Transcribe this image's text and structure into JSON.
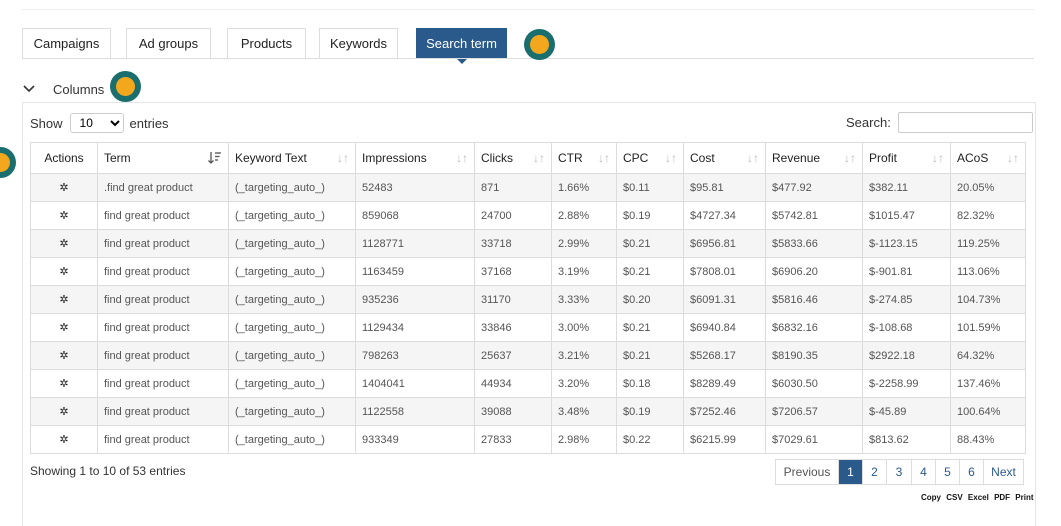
{
  "tabs": [
    {
      "label": "Campaigns",
      "active": false
    },
    {
      "label": "Ad groups",
      "active": false
    },
    {
      "label": "Products",
      "active": false
    },
    {
      "label": "Keywords",
      "active": false
    },
    {
      "label": "Search term",
      "active": true
    }
  ],
  "columns_toggle": {
    "label": "Columns"
  },
  "length": {
    "show": "Show",
    "value": "10",
    "entries": "entries"
  },
  "search": {
    "label": "Search:",
    "value": ""
  },
  "table": {
    "headers": [
      "Actions",
      "Term",
      "Keyword Text",
      "Impressions",
      "Clicks",
      "CTR",
      "CPC",
      "Cost",
      "Revenue",
      "Profit",
      "ACoS"
    ],
    "action_icon": "gear-icon",
    "rows": [
      {
        "action": "✲",
        "term": ".find great product",
        "keyword": "(_targeting_auto_)",
        "impressions": "52483",
        "clicks": "871",
        "ctr": "1.66%",
        "cpc": "$0.11",
        "cost": "$95.81",
        "revenue": "$477.92",
        "profit": "$382.11",
        "acos": "20.05%"
      },
      {
        "action": "✲",
        "term": "find great product",
        "keyword": "(_targeting_auto_)",
        "impressions": "859068",
        "clicks": "24700",
        "ctr": "2.88%",
        "cpc": "$0.19",
        "cost": "$4727.34",
        "revenue": "$5742.81",
        "profit": "$1015.47",
        "acos": "82.32%"
      },
      {
        "action": "✲",
        "term": "find great product",
        "keyword": "(_targeting_auto_)",
        "impressions": "1128771",
        "clicks": "33718",
        "ctr": "2.99%",
        "cpc": "$0.21",
        "cost": "$6956.81",
        "revenue": "$5833.66",
        "profit": "$-1123.15",
        "acos": "119.25%"
      },
      {
        "action": "✲",
        "term": "find great product",
        "keyword": "(_targeting_auto_)",
        "impressions": "1163459",
        "clicks": "37168",
        "ctr": "3.19%",
        "cpc": "$0.21",
        "cost": "$7808.01",
        "revenue": "$6906.20",
        "profit": "$-901.81",
        "acos": "113.06%"
      },
      {
        "action": "✲",
        "term": "find great product",
        "keyword": "(_targeting_auto_)",
        "impressions": "935236",
        "clicks": "31170",
        "ctr": "3.33%",
        "cpc": "$0.20",
        "cost": "$6091.31",
        "revenue": "$5816.46",
        "profit": "$-274.85",
        "acos": "104.73%"
      },
      {
        "action": "✲",
        "term": "find great product",
        "keyword": "(_targeting_auto_)",
        "impressions": "1129434",
        "clicks": "33846",
        "ctr": "3.00%",
        "cpc": "$0.21",
        "cost": "$6940.84",
        "revenue": "$6832.16",
        "profit": "$-108.68",
        "acos": "101.59%"
      },
      {
        "action": "✲",
        "term": "find great product",
        "keyword": "(_targeting_auto_)",
        "impressions": "798263",
        "clicks": "25637",
        "ctr": "3.21%",
        "cpc": "$0.21",
        "cost": "$5268.17",
        "revenue": "$8190.35",
        "profit": "$2922.18",
        "acos": "64.32%"
      },
      {
        "action": "✲",
        "term": "find great product",
        "keyword": "(_targeting_auto_)",
        "impressions": "1404041",
        "clicks": "44934",
        "ctr": "3.20%",
        "cpc": "$0.18",
        "cost": "$8289.49",
        "revenue": "$6030.50",
        "profit": "$-2258.99",
        "acos": "137.46%"
      },
      {
        "action": "✲",
        "term": "find great product",
        "keyword": "(_targeting_auto_)",
        "impressions": "1122558",
        "clicks": "39088",
        "ctr": "3.48%",
        "cpc": "$0.19",
        "cost": "$7252.46",
        "revenue": "$7206.57",
        "profit": "$-45.89",
        "acos": "100.64%"
      },
      {
        "action": "✲",
        "term": "find great product",
        "keyword": "(_targeting_auto_)",
        "impressions": "933349",
        "clicks": "27833",
        "ctr": "2.98%",
        "cpc": "$0.22",
        "cost": "$6215.99",
        "revenue": "$7029.61",
        "profit": "$813.62",
        "acos": "88.43%"
      }
    ]
  },
  "info": "Showing 1 to 10 of 53 entries",
  "pagination": {
    "previous": "Previous",
    "pages": [
      "1",
      "2",
      "3",
      "4",
      "5",
      "6"
    ],
    "current": "1",
    "next": "Next"
  },
  "export_buttons": [
    "Copy",
    "CSV",
    "Excel",
    "PDF",
    "Print"
  ],
  "colors": {
    "accent": "#2a5a8c",
    "marker_ring": "#1a6e6e",
    "marker_fill": "#f3a71c"
  }
}
